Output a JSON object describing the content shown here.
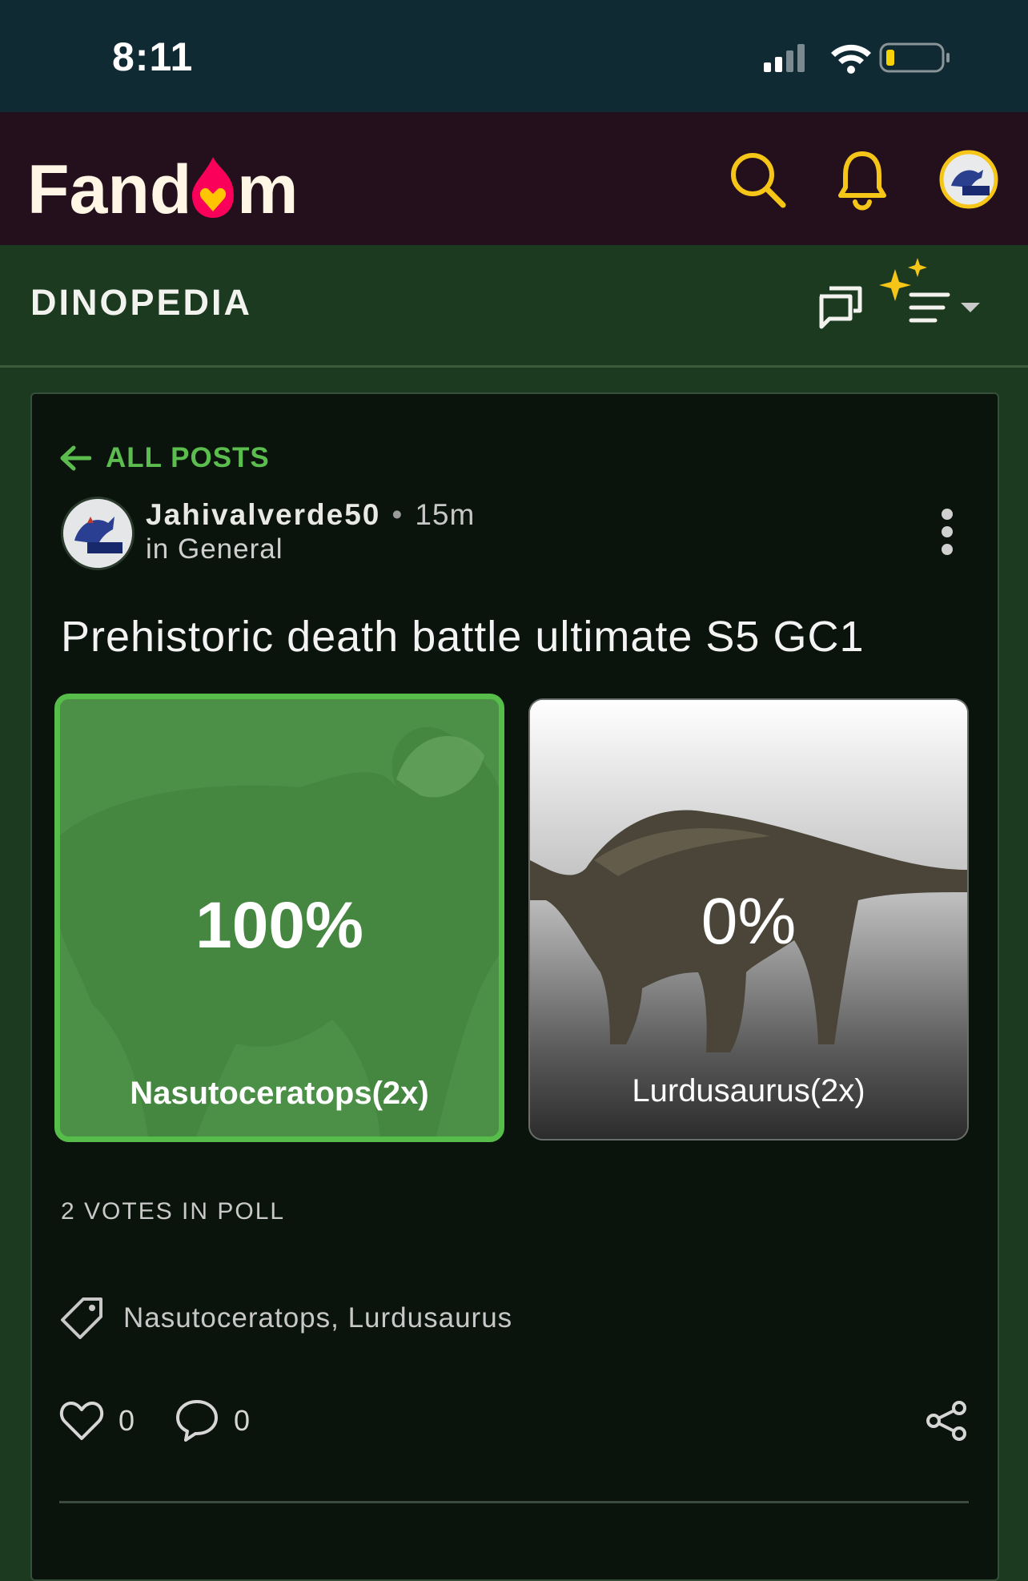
{
  "status_bar": {
    "time": "8:11"
  },
  "header": {
    "logo_text_left": "Fand",
    "logo_text_right": "m"
  },
  "subheader": {
    "wiki_name": "DINOPEDIA"
  },
  "post": {
    "back_label": "ALL POSTS",
    "author": "Jahivalverde50",
    "separator": "•",
    "time_ago": "15m",
    "category": "in General",
    "title": "Prehistoric death battle ultimate S5 GC1",
    "poll": {
      "options": [
        {
          "percent": "100%",
          "label": "Nasutoceratops(2x)",
          "selected": true
        },
        {
          "percent": "0%",
          "label": "Lurdusaurus(2x)",
          "selected": false
        }
      ],
      "votes": "2 VOTES IN POLL"
    },
    "tags": "Nasutoceratops, Lurdusaurus",
    "likes": "0",
    "comments": "0"
  },
  "colors": {
    "status_bg": "#0f2a33",
    "topbar_bg": "#240f1c",
    "theme_green": "#1c3a1f",
    "accent_yellow": "#f5c518",
    "fandom_red": "#fa005a",
    "poll_selected": "#56bd4a"
  }
}
